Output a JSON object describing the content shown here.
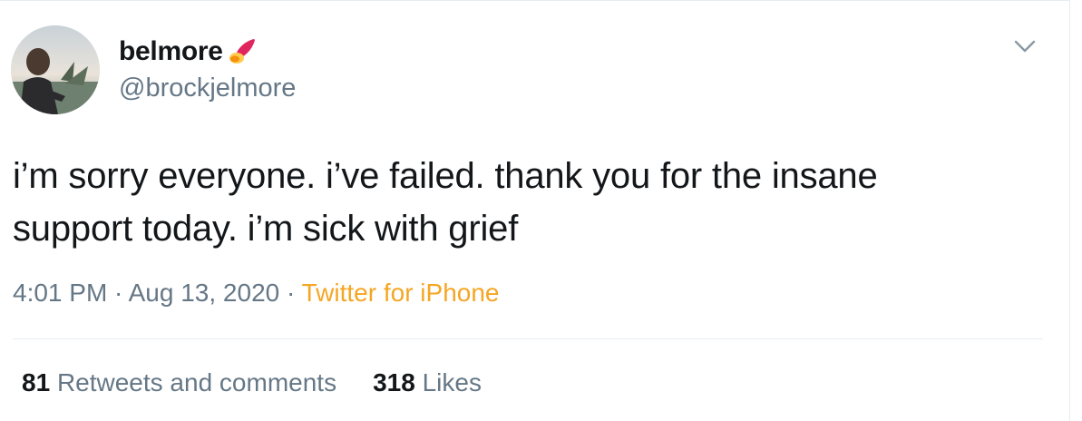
{
  "tweet": {
    "author": {
      "display_name": "belmore",
      "emoji": "rocket-emoji",
      "handle": "@brockjelmore"
    },
    "text_line1": "i’m sorry everyone. i’ve failed. thank you for the insane",
    "text_line2": "support today. i’m sick with grief",
    "time": "4:01 PM",
    "date": "Aug 13, 2020",
    "separator": " · ",
    "source": "Twitter for iPhone",
    "retweets_count": "81",
    "retweets_label": "Retweets and comments",
    "likes_count": "318",
    "likes_label": "Likes"
  },
  "icons": {
    "menu": "chevron-down-icon"
  },
  "colors": {
    "text": "#14171a",
    "secondary": "#657786",
    "source": "#f5a623",
    "divider": "#e6ecf0"
  }
}
